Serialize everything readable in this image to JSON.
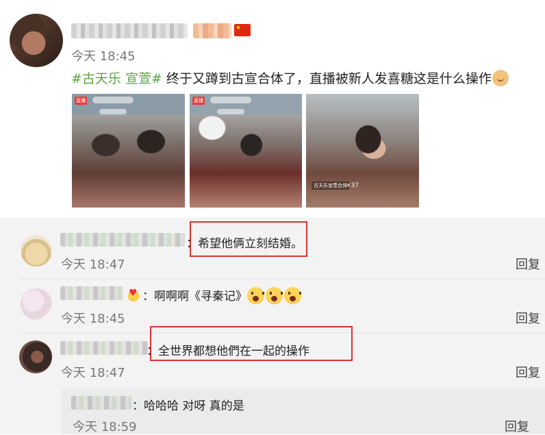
{
  "post": {
    "time": "今天 18:45",
    "topic": "#古天乐 宣萱#",
    "text": " 终于又蹲到古宣合体了，直播被新人发喜糖这是什么操作",
    "emoji": "doge-icon",
    "photos": [
      {
        "live_tag": "直播"
      },
      {
        "live_tag": "直播"
      },
      {
        "caption": "古天乐宣萱合体",
        "count": "×37"
      }
    ]
  },
  "comments": [
    {
      "text": "：希望他俩立刻结婚。",
      "time": "今天 18:47",
      "reply": "回复"
    },
    {
      "text_prefix": "：啊啊啊《寻秦记》",
      "emoji": "shocked-face-icon",
      "time": "今天 18:45",
      "reply": "回复"
    },
    {
      "text": "：全世界都想他們在一起的操作",
      "time": "今天 18:47",
      "reply": "回复",
      "subreply": {
        "text": "：哈哈哈 对呀 真的是",
        "time": "今天 18:59",
        "reply": "回复"
      }
    }
  ],
  "colors": {
    "topic": "#5aa43f",
    "highlight": "#d83333",
    "comments_bg": "#f3f3f3"
  }
}
